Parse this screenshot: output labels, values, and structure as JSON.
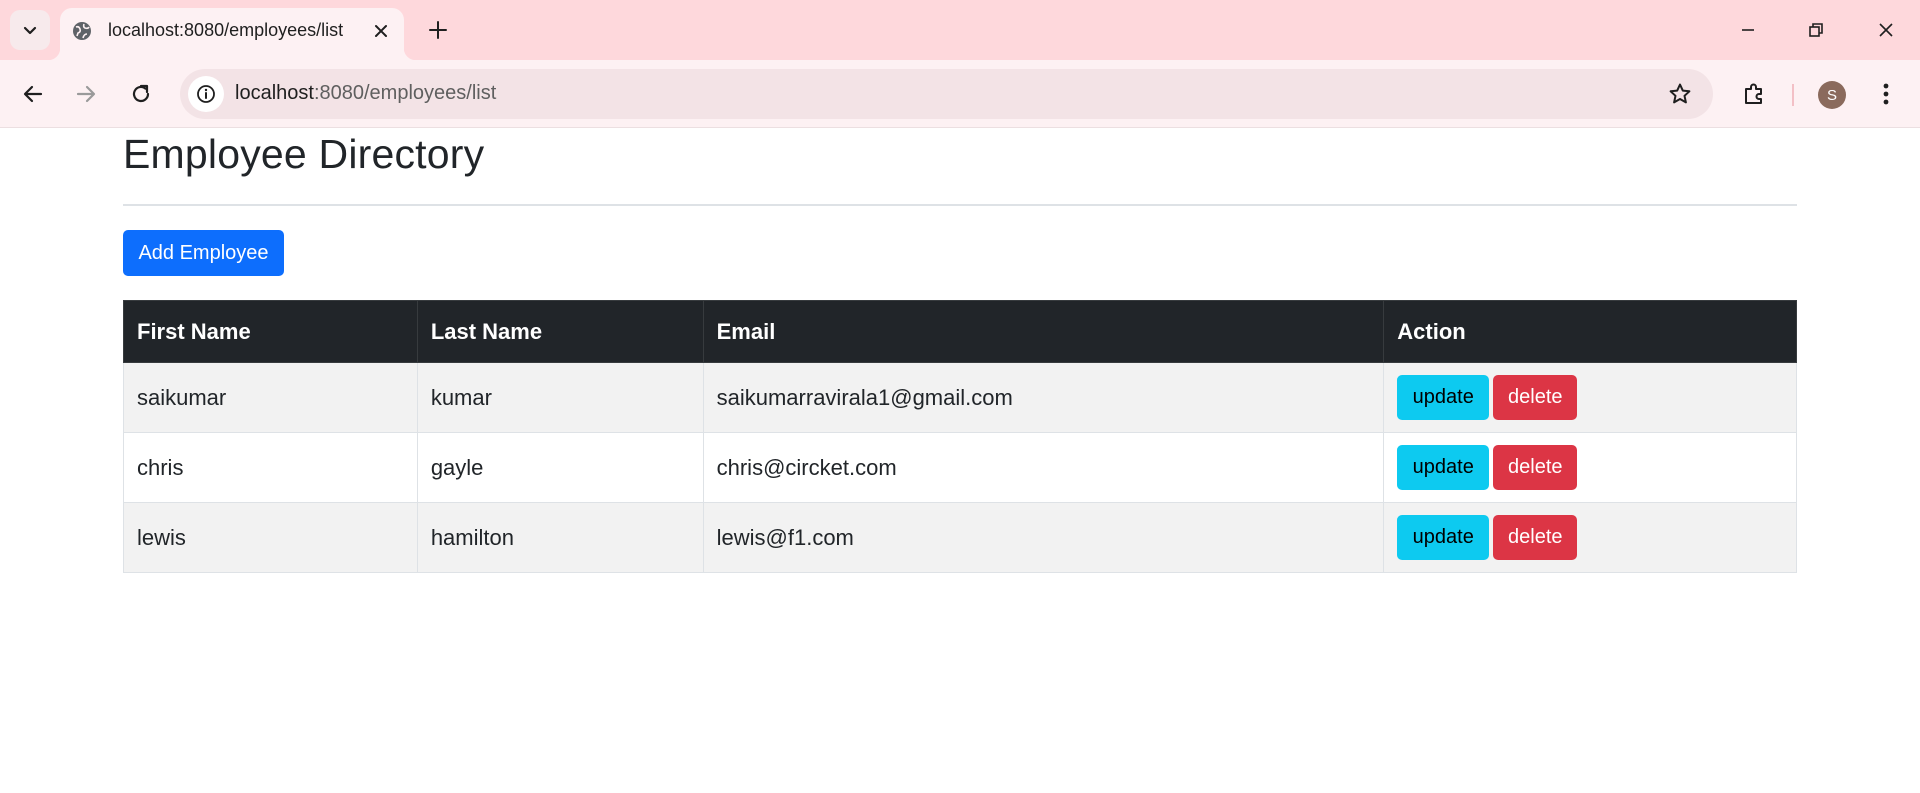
{
  "browser": {
    "tab_title": "localhost:8080/employees/list",
    "url_host": "localhost",
    "url_path": ":8080/employees/list",
    "profile_initial": "S",
    "theme_color": "#fed8dc"
  },
  "page": {
    "title": "Employee Directory",
    "add_button_label": "Add Employee",
    "table": {
      "headers": [
        "First Name",
        "Last Name",
        "Email",
        "Action"
      ],
      "rows": [
        {
          "first_name": "saikumar",
          "last_name": "kumar",
          "email": "saikumarravirala1@gmail.com",
          "update_label": "update",
          "delete_label": "delete"
        },
        {
          "first_name": "chris",
          "last_name": "gayle",
          "email": "chris@circket.com",
          "update_label": "update",
          "delete_label": "delete"
        },
        {
          "first_name": "lewis",
          "last_name": "hamilton",
          "email": "lewis@f1.com",
          "update_label": "update",
          "delete_label": "delete"
        }
      ]
    }
  },
  "colors": {
    "primary": "#0d6efd",
    "info": "#0dcaf0",
    "danger": "#dc3545",
    "table_header": "#212529"
  },
  "icons": [
    "tab-search-icon",
    "globe-icon",
    "close-icon",
    "plus-icon",
    "minimize-icon",
    "restore-icon",
    "window-close-icon",
    "back-arrow-icon",
    "forward-arrow-icon",
    "reload-icon",
    "info-icon",
    "star-icon",
    "extensions-icon",
    "more-vert-icon"
  ]
}
